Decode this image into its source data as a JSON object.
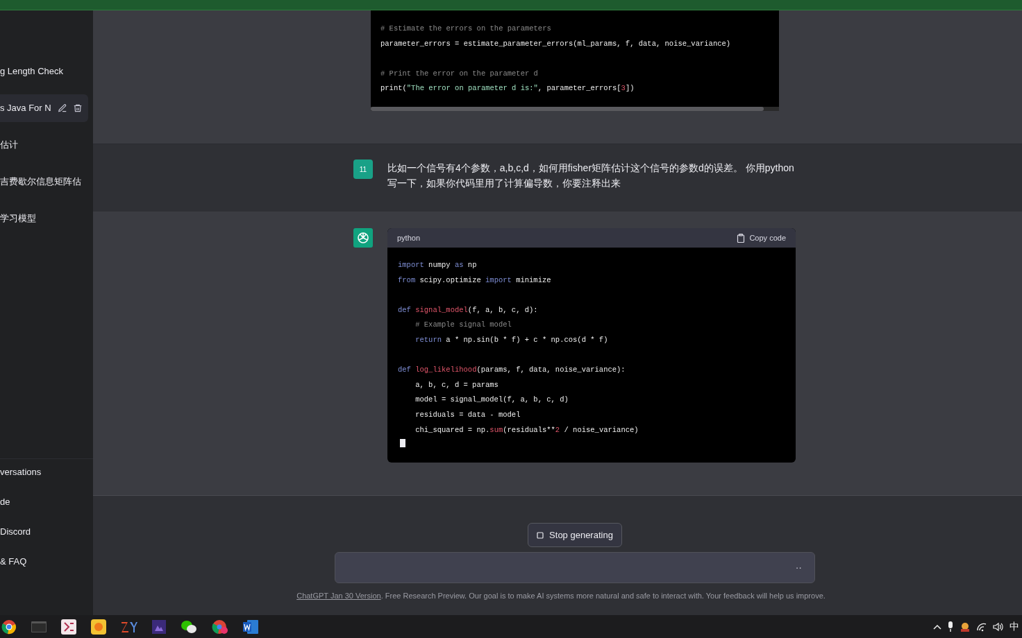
{
  "sidebar": {
    "conversations": [
      {
        "title": "g Length Check",
        "selected": false
      },
      {
        "title": "s Java For N",
        "selected": true
      },
      {
        "title": "估计",
        "selected": false
      },
      {
        "title": "吉费歇尔信息矩阵估",
        "selected": false
      },
      {
        "title": "学习模型",
        "selected": false
      }
    ],
    "links": [
      "versations",
      "de",
      "Discord",
      "& FAQ"
    ]
  },
  "messages": [
    {
      "kind": "code_tail",
      "code": [
        {
          "kind": "code",
          "indent": false,
          "tokens": [
            {
              "kind": "comment",
              "text": "# Estimate the errors on the parameters"
            }
          ]
        },
        {
          "kind": "code",
          "indent": false,
          "tokens": [
            {
              "kind": "plain",
              "text": "parameter_errors = estimate_parameter_errors(ml_params, f, data, noise_variance)"
            }
          ]
        },
        {
          "kind": "blank"
        },
        {
          "kind": "code",
          "indent": false,
          "tokens": [
            {
              "kind": "comment",
              "text": "# Print the error on the parameter d"
            }
          ]
        },
        {
          "kind": "code",
          "indent": false,
          "tokens": [
            {
              "kind": "plain",
              "text": "print("
            },
            {
              "kind": "string",
              "text": "\"The error on parameter d is:\""
            },
            {
              "kind": "plain",
              "text": ", parameter_errors["
            },
            {
              "kind": "number",
              "text": "3"
            },
            {
              "kind": "plain",
              "text": "])"
            }
          ]
        }
      ]
    },
    {
      "kind": "user",
      "avatar": "11",
      "text": "比如一个信号有4个参数，a,b,c,d，如何用fisher矩阵估计这个信号的参数d的误差。 你用python写一下，如果你代码里用了计算偏导数，你要注释出来"
    },
    {
      "kind": "assistant",
      "language": "python",
      "copy_label": "Copy code",
      "code": [
        {
          "kind": "code",
          "indent": false,
          "tokens": [
            {
              "kind": "keyword",
              "text": "import"
            },
            {
              "kind": "plain",
              "text": " numpy "
            },
            {
              "kind": "keyword",
              "text": "as"
            },
            {
              "kind": "plain",
              "text": " np"
            }
          ]
        },
        {
          "kind": "code",
          "indent": false,
          "tokens": [
            {
              "kind": "keyword",
              "text": "from"
            },
            {
              "kind": "plain",
              "text": " scipy.optimize "
            },
            {
              "kind": "keyword",
              "text": "import"
            },
            {
              "kind": "plain",
              "text": " minimize"
            }
          ]
        },
        {
          "kind": "blank"
        },
        {
          "kind": "code",
          "indent": false,
          "tokens": [
            {
              "kind": "keyword",
              "text": "def "
            },
            {
              "kind": "function",
              "text": "signal_model"
            },
            {
              "kind": "plain",
              "text": "(f, a, b, c, d):"
            }
          ]
        },
        {
          "kind": "code",
          "indent": true,
          "tokens": [
            {
              "kind": "comment",
              "text": "# Example signal model"
            }
          ]
        },
        {
          "kind": "code",
          "indent": true,
          "tokens": [
            {
              "kind": "keyword",
              "text": "return"
            },
            {
              "kind": "plain",
              "text": " a * np.sin(b * f) + c * np.cos(d * f)"
            }
          ]
        },
        {
          "kind": "blank"
        },
        {
          "kind": "code",
          "indent": false,
          "tokens": [
            {
              "kind": "keyword",
              "text": "def "
            },
            {
              "kind": "function",
              "text": "log_likelihood"
            },
            {
              "kind": "plain",
              "text": "(params, f, data, noise_variance):"
            }
          ]
        },
        {
          "kind": "code",
          "indent": true,
          "tokens": [
            {
              "kind": "plain",
              "text": "a, b, c, d = params"
            }
          ]
        },
        {
          "kind": "code",
          "indent": true,
          "tokens": [
            {
              "kind": "plain",
              "text": "model = signal_model(f, a, b, c, d)"
            }
          ]
        },
        {
          "kind": "code",
          "indent": true,
          "tokens": [
            {
              "kind": "plain",
              "text": "residuals = data - model"
            }
          ]
        },
        {
          "kind": "code",
          "indent": true,
          "tokens": [
            {
              "kind": "plain",
              "text": "chi_squared = np."
            },
            {
              "kind": "function",
              "text": "sum"
            },
            {
              "kind": "plain",
              "text": "(residuals**"
            },
            {
              "kind": "number",
              "text": "2"
            },
            {
              "kind": "plain",
              "text": " / noise_variance)"
            }
          ]
        }
      ],
      "streaming": true
    }
  ],
  "composer": {
    "stop_label": "Stop generating",
    "status": "··"
  },
  "footer": {
    "link": "ChatGPT Jan 30 Version",
    "text": ". Free Research Preview. Our goal is to make AI systems more natural and safe to interact with. Your feedback will help us improve."
  },
  "taskbar": {
    "ime": "中"
  }
}
